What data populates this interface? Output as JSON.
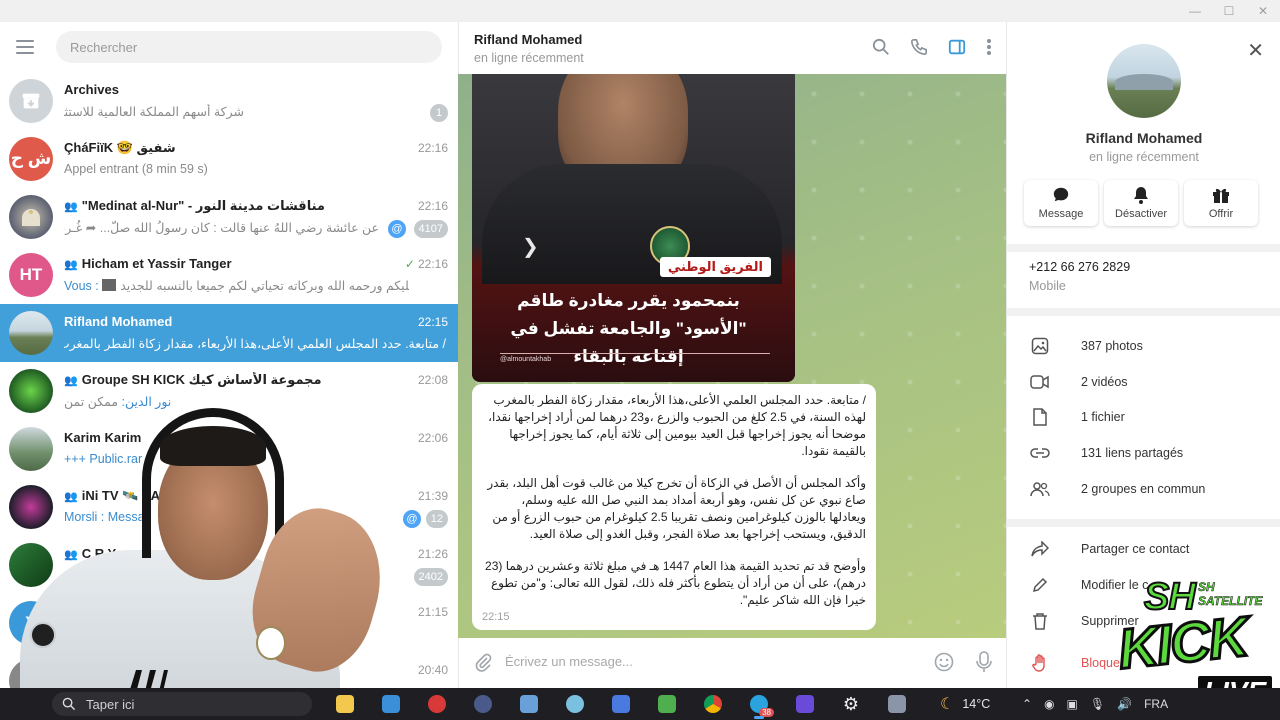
{
  "window": {
    "controls": [
      "—",
      "☐",
      "✕"
    ]
  },
  "left": {
    "search_placeholder": "Rechercher",
    "chats": [
      {
        "name": "Archives",
        "preview": "شركة أسهم المملكة العالمية للاستثمار",
        "time": "",
        "badge": "1",
        "avatar_text": "",
        "avatar_color": "#cfd4d8",
        "group": false
      },
      {
        "name": "ÇháFiïK 🤓 شفيق",
        "preview": "Appel entrant (8 min 59 s)",
        "time": "22:16",
        "badge": "",
        "avatar_text": "ش ح",
        "avatar_color": "#e05a4b",
        "group": false
      },
      {
        "name": "\"Medinat al-Nur\" - مناقشات مدينة النور",
        "preview": "عن عائشة رضي اللهُ عنها قالت : كان رسولُ الله صلّ... ➦ غُـربـاء",
        "time": "22:16",
        "badge": "4107",
        "avatar_text": "",
        "avatar_color": "#7a7f8c",
        "group": true,
        "mention": true
      },
      {
        "name": "Hicham et Yassir Tanger",
        "preview_prefix": "Vous : ",
        "preview": "السلام عليكم ورحمه الله وبركاته تحياتي لكم جميعا بالنسبه للجديد ...",
        "time": "22:16",
        "badge": "",
        "avatar_text": "HT",
        "avatar_color": "#e0588a",
        "group": true,
        "sent": true
      },
      {
        "name": "Rifland Mohamed",
        "preview": "/ متابعة. حدد المجلس العلمي الأعلى،هذا الأربعاء، مقدار زكاة الفطر بالمغرب لهذه ...",
        "time": "22:15",
        "badge": "",
        "avatar_text": "",
        "avatar_color": "#8ea6b3",
        "group": false,
        "active": true
      },
      {
        "name": "Groupe SH KICK مجموعة الأساش كيك",
        "preview_prefix": "نور الدين: ",
        "preview": "ممكن تمن",
        "time": "22:08",
        "badge": "",
        "avatar_text": "",
        "avatar_color": "#2c6b2e",
        "group": true
      },
      {
        "name": "Karim Karim",
        "preview": "+++ Public.rar",
        "time": "22:06",
        "badge": "",
        "avatar_text": "",
        "avatar_color": "#6f8f6a",
        "group": false
      },
      {
        "name": "iNi TV 🛰️ SA",
        "preview": "Morsli : Messag",
        "time": "21:39",
        "badge": "12",
        "avatar_text": "",
        "avatar_color": "#1e1e2a",
        "group": true,
        "mention": true
      },
      {
        "name": "C R Y",
        "preview": "C",
        "time": "21:26",
        "badge": "2402",
        "avatar_text": "",
        "avatar_color": "#2e7d3a",
        "group": true
      },
      {
        "name": "",
        "preview": "",
        "time": "21:15",
        "badge": "",
        "avatar_text": "Y",
        "avatar_color": "#3a9ad9",
        "group": false
      },
      {
        "name": "",
        "preview": "",
        "time": "20:40",
        "badge": "",
        "avatar_text": "",
        "avatar_color": "#888888",
        "group": false
      }
    ]
  },
  "chat": {
    "name": "Rifland Mohamed",
    "status": "en ligne récemment",
    "photo_tag": "الفريق الوطني",
    "photo_headline": "بنمحمود يقرر مغادرة طاقم \"الأسود\" والجامعة تفشل في إقناعه بالبقاء",
    "photo_credit": "@almountakhab",
    "message_paragraphs": [
      "/ متابعة. حدد المجلس العلمي الأعلى،هذا الأربعاء، مقدار زكاة الفطر بالمغرب لهذه السنة، في 2.5 كلغ من الحبوب والزرع ،و23 درهما لمن أراد إخراجها نقدا، موضحا أنه يجوز إخراجها قبل العيد بيومين إلى ثلاثة أيام، كما يجوز إخراجها بالقيمة نقودا.",
      "وأكد المجلس أن الأصل في الزكاة أن تخرج كيلا من غالب قوت أهل البلد، بقدر صاع نبوي عن كل نفس، وهو أربعة أمداد بمد النبي صل الله عليه وسلم، ويعادلها بالوزن كيلوغرامين ونصف تقريبا 2.5 كيلوغرام من حبوب الزرع أو من الدقيق، ويستحب إخراجها بعد صلاة الفجر، وقبل الغدو إلى صلاة العيد.",
      "وأوضح قد تم تحديد القيمة هذا العام 1447 هـ في مبلغ ثلاثة وعشرين درهما (23 درهم)، على أن من أراد أن يتطوع بأكثر فله ذلك، لقول الله تعالى: و\"من تطوع خيرا فإن الله شاكر عليم\"."
    ],
    "message_time": "22:15",
    "composer_placeholder": "Écrivez un message..."
  },
  "profile": {
    "name": "Rifland Mohamed",
    "status": "en ligne récemment",
    "actions": [
      "Message",
      "Désactiver",
      "Offrir"
    ],
    "phone": "+212 66 276 2829",
    "phone_label": "Mobile",
    "media": [
      "387 photos",
      "2 vidéos",
      "1 fichier",
      "131 liens partagés",
      "2 groupes en commun"
    ],
    "more_actions": [
      "Partager ce contact",
      "Modifier le c",
      "Supprimer",
      "Bloque"
    ]
  },
  "brand": {
    "sh": "SH",
    "satellite": "SH SATELLITE",
    "kick": "KICK",
    "live": "LIVE",
    "num": "1"
  },
  "taskbar": {
    "search": "Taper ici",
    "weather": "14°C",
    "lang": "FRA",
    "telegram_badge": "38"
  },
  "colors": {
    "active_chat": "#419fd9",
    "accent": "#4ea4f6",
    "danger": "#e05353"
  }
}
